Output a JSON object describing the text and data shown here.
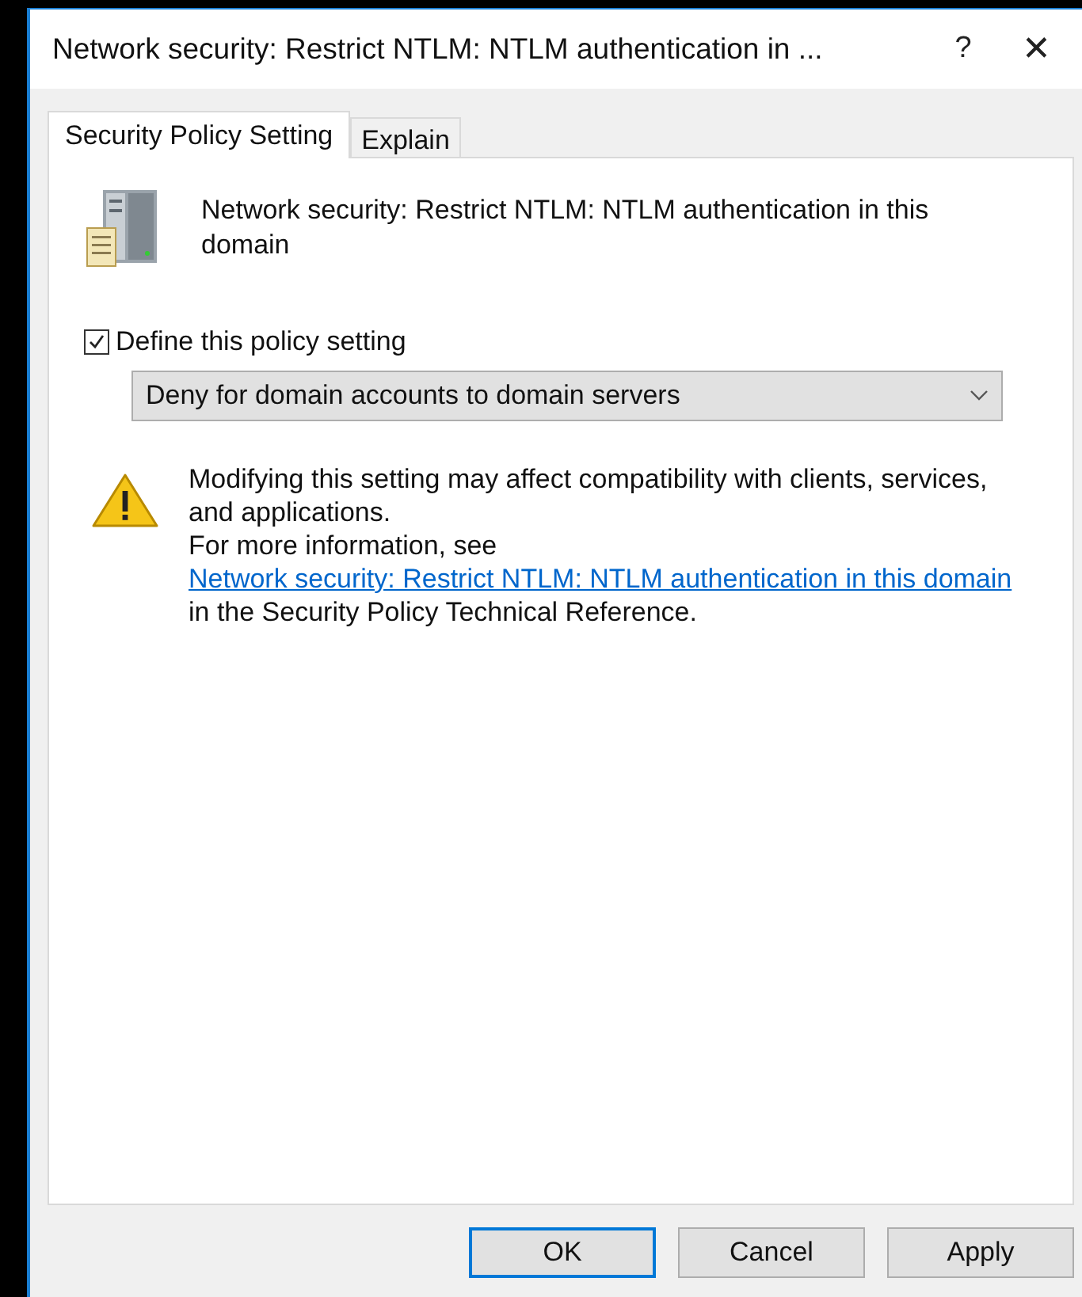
{
  "window": {
    "title": "Network security: Restrict NTLM: NTLM authentication in ...",
    "help": "?",
    "close": "✕"
  },
  "tabs": [
    {
      "label": "Security Policy Setting",
      "selected": true
    },
    {
      "label": "Explain",
      "selected": false
    }
  ],
  "policy_name": "Network security: Restrict NTLM: NTLM authentication in this domain",
  "define_checkbox": {
    "label": "Define this policy setting",
    "checked": true
  },
  "dropdown": {
    "value": "Deny for domain accounts to domain servers"
  },
  "warning": {
    "text": "Modifying this setting may affect compatibility with clients, services, and applications.",
    "more_prefix": "For more information, see ",
    "link": "Network security: Restrict NTLM: NTLM authentication in this domain",
    "more_suffix": " in the Security Policy Technical Reference."
  },
  "buttons": [
    {
      "label": "OK",
      "default": true
    },
    {
      "label": "Cancel",
      "default": false
    },
    {
      "label": "Apply",
      "default": false
    }
  ]
}
